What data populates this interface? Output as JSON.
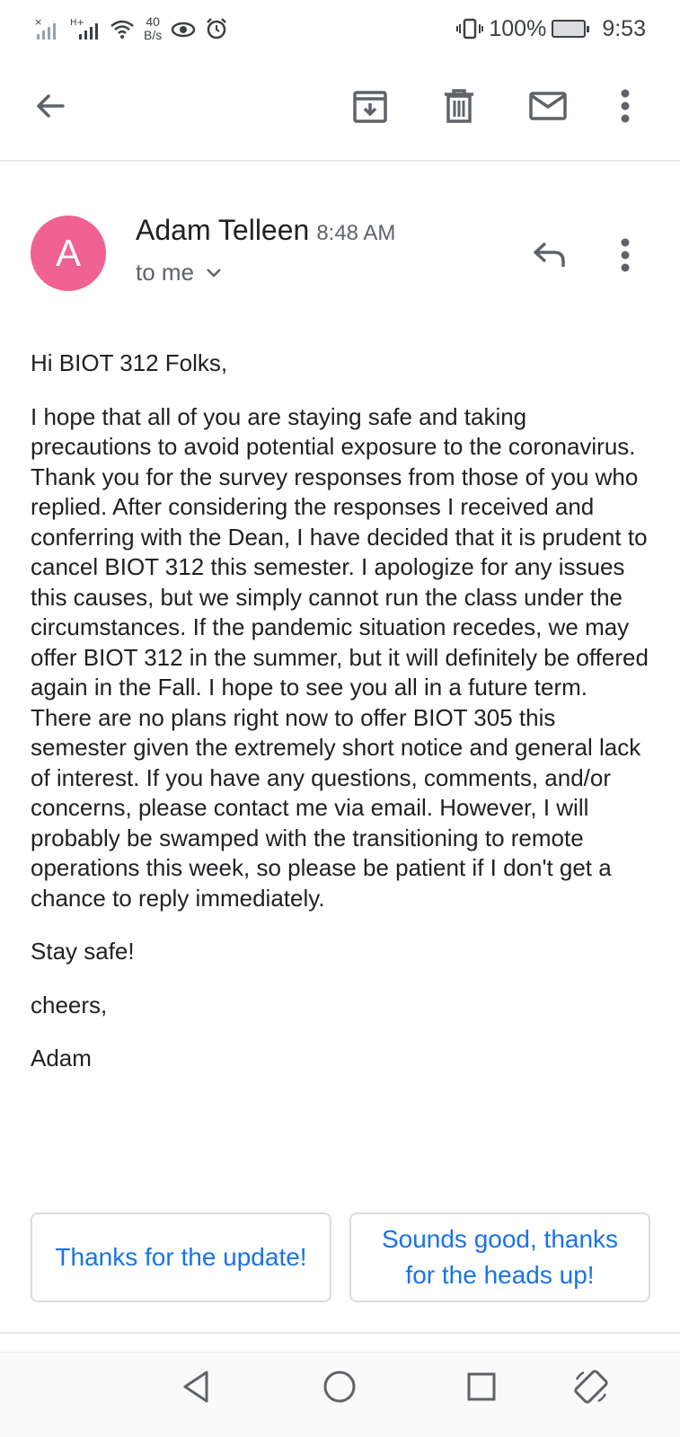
{
  "status_bar": {
    "net_speed_value": "40",
    "net_speed_unit": "B/s",
    "battery": "100%",
    "time": "9:53"
  },
  "toolbar": {
    "back_icon": "arrow-left-icon",
    "archive_icon": "archive-icon",
    "delete_icon": "trash-icon",
    "mark_unread_icon": "mail-icon",
    "more_icon": "more-vertical-icon"
  },
  "email": {
    "avatar_letter": "A",
    "avatar_color": "#f06292",
    "sender": "Adam Telleen",
    "time": "8:48 AM",
    "recipient": "to me",
    "greeting": "Hi BIOT 312 Folks,",
    "paragraphs": [
      "I hope that all of you are staying safe and taking precautions to avoid potential exposure to the coronavirus. Thank you for the survey responses from those of you who replied. After considering the responses I received and conferring with the Dean, I have decided that it is prudent to cancel BIOT 312 this semester. I apologize for any issues this causes, but we simply cannot run the class under the circumstances. If the pandemic situation recedes, we may offer BIOT 312 in the summer, but it will definitely be offered again in the Fall. I hope to see you all in a future term. There are no plans right now to offer BIOT 305 this semester given the extremely short notice and general lack of interest. If you have any questions, comments, and/or concerns, please contact me via email. However, I will probably be swamped with the transitioning to remote operations this week, so please be patient if I don't get a chance to reply immediately.",
      "Stay safe!",
      "cheers,",
      "Adam"
    ]
  },
  "smart_replies": [
    "Thanks for the update!",
    "Sounds good, thanks for the heads up!"
  ],
  "accent_color": "#1a73e8"
}
